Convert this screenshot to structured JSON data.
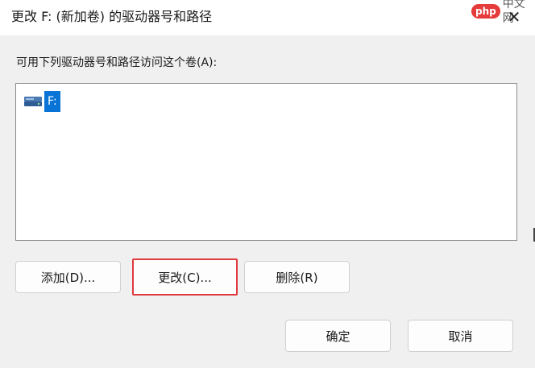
{
  "window": {
    "title": "更改 F: (新加卷) 的驱动器号和路径",
    "close_glyph": "✕"
  },
  "watermark": {
    "badge": "php",
    "text": "中文网"
  },
  "dialog": {
    "prompt": "可用下列驱动器号和路径访问这个卷(A):",
    "list_items": [
      {
        "icon": "drive-icon",
        "label": "F:",
        "selected": true
      }
    ]
  },
  "buttons": {
    "add": "添加(D)...",
    "change": "更改(C)...",
    "remove": "删除(R)",
    "ok": "确定",
    "cancel": "取消"
  },
  "colors": {
    "selection": "#0a74d6",
    "highlight_border": "#e0393e",
    "background": "#f0f0f0"
  }
}
